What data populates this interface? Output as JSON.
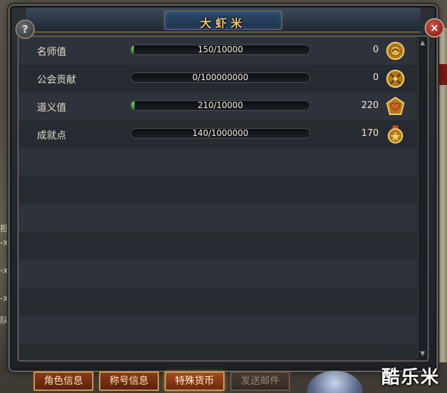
{
  "window": {
    "title": "大虾米",
    "help_label": "?",
    "close_label": "×"
  },
  "currencies": [
    {
      "name": "名师值",
      "progress_text": "150/10000",
      "progress": 0.015,
      "count": "0",
      "icon": "mentor-medal-icon",
      "color": "#d6a23a"
    },
    {
      "name": "公会贡献",
      "progress_text": "0/100000000",
      "progress": 0.0,
      "count": "0",
      "icon": "guild-crossed-swords-icon",
      "color": "#d6a23a"
    },
    {
      "name": "道义值",
      "progress_text": "210/10000",
      "progress": 0.021,
      "count": "220",
      "icon": "heart-medal-icon",
      "color": "#d6a23a"
    },
    {
      "name": "成就点",
      "progress_text": "140/1000000",
      "progress": 0.00014,
      "count": "170",
      "icon": "achievement-medal-icon",
      "color": "#d6a23a"
    }
  ],
  "tabs": [
    {
      "label": "角色信息",
      "active": false
    },
    {
      "label": "称号信息",
      "active": false
    },
    {
      "label": "特殊货币",
      "active": true
    },
    {
      "label": "发送邮件",
      "active": false
    }
  ],
  "background": {
    "left_text": [
      "担",
      "-x",
      "-x",
      "-x",
      "队"
    ]
  },
  "watermark": "酷乐米",
  "colors": {
    "title": "#f2c66a",
    "tab_active": "#a34a1e",
    "progress_fill": "#7fd36a"
  }
}
